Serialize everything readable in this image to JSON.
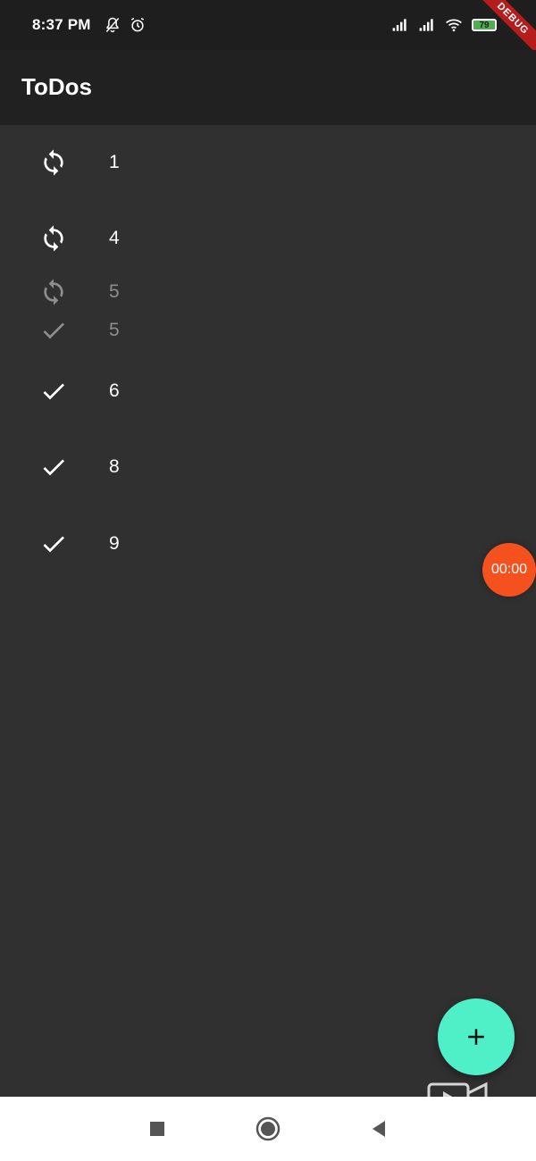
{
  "status_bar": {
    "time": "8:37 PM",
    "battery": "79",
    "debug_label": "DEBUG",
    "icons": [
      "mute-icon",
      "alarm-icon",
      "signal-icon",
      "signal-icon",
      "wifi-icon",
      "battery-icon"
    ]
  },
  "app_bar": {
    "title": "ToDos"
  },
  "todos": [
    {
      "label": "1",
      "icon": "sync-icon",
      "faded": false
    },
    {
      "label": "4",
      "icon": "sync-icon",
      "faded": false
    },
    {
      "label": "5",
      "icon": "sync-icon",
      "faded": true
    },
    {
      "label": "5",
      "icon": "check-icon",
      "faded": true
    },
    {
      "label": "6",
      "icon": "check-icon",
      "faded": false
    },
    {
      "label": "8",
      "icon": "check-icon",
      "faded": false
    },
    {
      "label": "9",
      "icon": "check-icon",
      "faded": false
    }
  ],
  "recorder": {
    "time": "00:00"
  },
  "fab": {
    "icon": "add-icon",
    "color": "#4ff0c8"
  },
  "nav_bar": {
    "icons": [
      "recents-icon",
      "home-icon",
      "back-icon"
    ]
  },
  "colors": {
    "background": "#303030",
    "app_bar": "#212121",
    "recorder": "#f4511e"
  }
}
